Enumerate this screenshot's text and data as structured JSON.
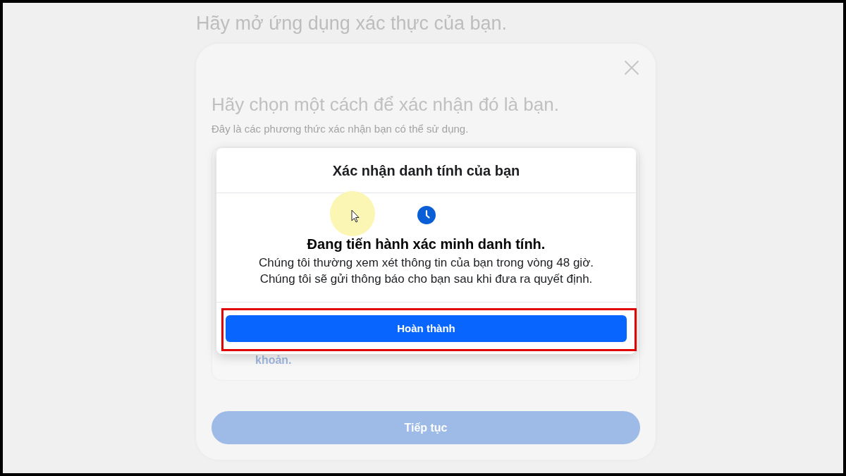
{
  "background_page": {
    "title": "Hãy mở ứng dụng xác thực của bạn."
  },
  "verification_dialog": {
    "heading": "Hãy chọn một cách để xác nhận đó là bạn.",
    "subtitle": "Đây là các phương thức xác nhận bạn có thể sử dụng.",
    "option_text": "khoản.",
    "continue_button": {
      "label": "Tiếp tục",
      "disabled": true
    }
  },
  "status_modal": {
    "title": "Xác nhận danh tính của bạn",
    "heading": "Đang tiến hành xác minh danh tính.",
    "message_lines": [
      "Chúng tôi thường xem xét thông tin của bạn trong vòng 48 giờ.",
      "Chúng tôi sẽ gửi thông báo cho bạn sau khi đưa ra quyết định."
    ],
    "done_button": {
      "label": "Hoàn thành"
    }
  }
}
